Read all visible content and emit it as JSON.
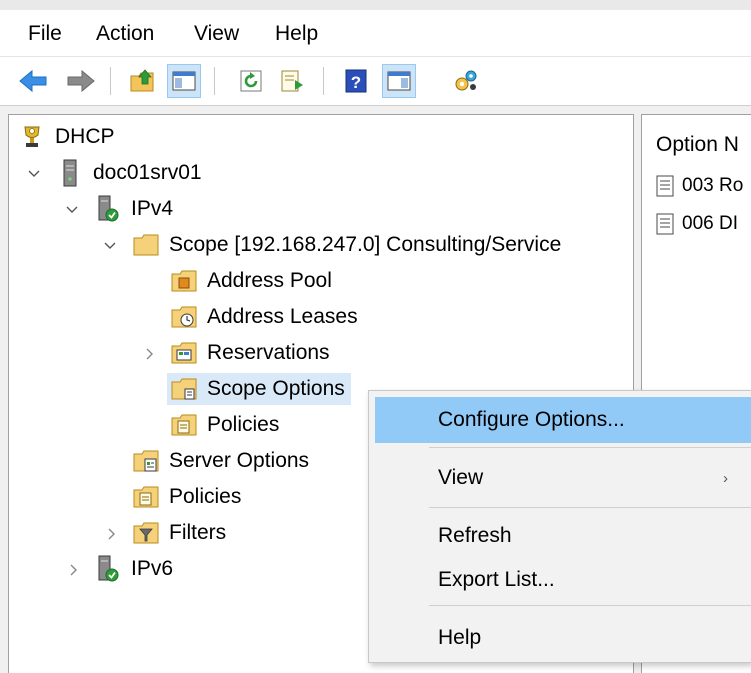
{
  "menubar": {
    "items": [
      "File",
      "Action",
      "View",
      "Help"
    ]
  },
  "toolbar": {
    "buttons": [
      {
        "name": "back-arrow-icon"
      },
      {
        "name": "forward-arrow-icon"
      },
      {
        "name": "up-folder-icon"
      },
      {
        "name": "show-hide-console-tree-icon"
      },
      {
        "name": "refresh-icon"
      },
      {
        "name": "export-list-icon"
      },
      {
        "name": "help-icon"
      },
      {
        "name": "show-hide-action-pane-icon"
      },
      {
        "name": "properties-icon"
      }
    ]
  },
  "tree": {
    "root": "DHCP",
    "server": "doc01srv01",
    "ipv4": "IPv4",
    "scope": "Scope [192.168.247.0] Consulting/Service",
    "address_pool": "Address Pool",
    "address_leases": "Address Leases",
    "reservations": "Reservations",
    "scope_options": "Scope Options",
    "scope_policies": "Policies",
    "server_options": "Server Options",
    "server_policies": "Policies",
    "filters": "Filters",
    "ipv6": "IPv6"
  },
  "right_pane": {
    "column_header": "Option N",
    "rows": [
      "003 Ro",
      "006 DI"
    ]
  },
  "context_menu": {
    "configure_options": "Configure Options...",
    "view": "View",
    "submenu_arrow": "›",
    "refresh": "Refresh",
    "export_list": "Export List...",
    "help": "Help"
  }
}
